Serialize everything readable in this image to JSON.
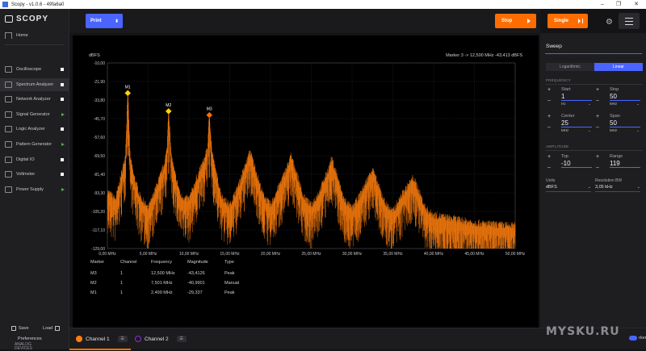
{
  "window": {
    "title": "Scopy - v1.0.6 - 49fa6a0",
    "controls": [
      "–",
      "❐",
      "✕"
    ]
  },
  "app": {
    "name": "SCOPY"
  },
  "sidebar": {
    "home": "Home",
    "items": [
      {
        "label": "Oscilloscope",
        "icon": "oscilloscope-icon",
        "state": "square"
      },
      {
        "label": "Spectrum Analyzer",
        "icon": "spectrum-icon",
        "state": "square",
        "active": true
      },
      {
        "label": "Network Analyzer",
        "icon": "network-icon",
        "state": "square"
      },
      {
        "label": "Signal Generator",
        "icon": "signal-icon",
        "state": "play"
      },
      {
        "label": "Logic Analyzer",
        "icon": "logic-icon",
        "state": "square"
      },
      {
        "label": "Pattern Generator",
        "icon": "pattern-icon",
        "state": "play"
      },
      {
        "label": "Digital IO",
        "icon": "digital-io-icon",
        "state": "square"
      },
      {
        "label": "Voltmeter",
        "icon": "voltmeter-icon",
        "state": "square"
      },
      {
        "label": "Power Supply",
        "icon": "power-icon",
        "state": "play"
      }
    ],
    "save": "Save",
    "load": "Load",
    "preferences": "Preferences",
    "brand_line1": "ANALOG",
    "brand_line2": "DEVICES"
  },
  "toolbar": {
    "print": "Print",
    "print_selector": "⬍",
    "stop": "Stop",
    "single": "Single"
  },
  "plot": {
    "unit_label": "dBFS",
    "marker_readout": "Marker 3 -> 12,500 MHz -43,413 dBFS",
    "y_ticks": [
      "-10,00",
      "-21,90",
      "-33,80",
      "-45,70",
      "-57,60",
      "-69,50",
      "-81,40",
      "-93,30",
      "-105,20",
      "-117,10",
      "-129,00"
    ],
    "x_ticks": [
      "0,00 MHz",
      "5,00 MHz",
      "10,00 MHz",
      "15,00 MHz",
      "20,00 MHz",
      "25,00 MHz",
      "30,00 MHz",
      "35,00 MHz",
      "40,00 MHz",
      "45,00 MHz",
      "50,00 MHz"
    ],
    "trace_color": "#ff7f0e",
    "markers": [
      {
        "name": "M1",
        "freq_mhz": 2.499,
        "dbfs": -29.337,
        "color": "#ffd400"
      },
      {
        "name": "M2",
        "freq_mhz": 7.501,
        "dbfs": -40.99,
        "color": "#ffd400"
      },
      {
        "name": "M3",
        "freq_mhz": 12.5,
        "dbfs": -43.41,
        "color": "#ff6d00"
      }
    ]
  },
  "marker_table": {
    "headers": [
      "Marker",
      "Channel",
      "Frequency",
      "Magnitude",
      "Type"
    ],
    "rows": [
      [
        "M3",
        "1",
        "12,500 MHz",
        "-43,4126",
        "Peak"
      ],
      [
        "M2",
        "1",
        "7,501 MHz",
        "-40,9901",
        "Manual"
      ],
      [
        "M1",
        "1",
        "2,499 MHz",
        "-29,337",
        "Peak"
      ]
    ]
  },
  "bottom": {
    "channel1": "Channel 1",
    "channel1_color": "#ff7f0e",
    "channel2": "Channel 2",
    "channel2_color": "#8a2be2",
    "menu_glyph": "☰",
    "markers_label": "rkers",
    "watermark": "MYSKU.RU"
  },
  "right_panel": {
    "title": "Sweep",
    "scale_logarithmic": "Logarithmic",
    "scale_linear": "Linear",
    "frequency_section": "FREQUENCY",
    "start": {
      "label": "Start",
      "value": "1",
      "unit": "Hz"
    },
    "stop": {
      "label": "Stop",
      "value": "50",
      "unit": "MHz"
    },
    "center": {
      "label": "Center",
      "value": "25",
      "unit": "MHz"
    },
    "span": {
      "label": "Span",
      "value": "50",
      "unit": "MHz"
    },
    "amplitude_section": "AMPLITUDE",
    "top": {
      "label": "Top",
      "value": "-10"
    },
    "range": {
      "label": "Range",
      "value": "119"
    },
    "units": {
      "label": "Units",
      "value": "dBFS"
    },
    "resolution_bw": {
      "label": "Resolution BW",
      "value": "3,05 kHz"
    }
  },
  "chart_data": {
    "type": "line",
    "title": "",
    "xlabel": "",
    "ylabel": "dBFS",
    "xlim": [
      0,
      50
    ],
    "ylim": [
      -129,
      -10
    ],
    "x_unit": "MHz",
    "grid": true,
    "series": [
      {
        "x": [
          0,
          1,
          1.8,
          2.2,
          2.499,
          2.8,
          3.2,
          4,
          5,
          6,
          6.9,
          7.3,
          7.501,
          7.8,
          8.2,
          9,
          10,
          11,
          11.9,
          12.3,
          12.5,
          12.8,
          13.2,
          14,
          15,
          16,
          17,
          17.5,
          18,
          19,
          20,
          21,
          22,
          22.5,
          23,
          24,
          25,
          26,
          27,
          27.5,
          28,
          29,
          30,
          31,
          32,
          32.5,
          33,
          34,
          35,
          36,
          37,
          37.5,
          38,
          39,
          40,
          42,
          45,
          47,
          50
        ],
        "y": [
          -95,
          -100,
          -82,
          -72,
          -29.3,
          -73,
          -84,
          -98,
          -106,
          -92,
          -79,
          -68,
          -41,
          -70,
          -82,
          -98,
          -100,
          -86,
          -74,
          -66,
          -43.4,
          -68,
          -80,
          -98,
          -104,
          -92,
          -77,
          -69,
          -78,
          -96,
          -104,
          -92,
          -80,
          -72,
          -80,
          -98,
          -104,
          -95,
          -82,
          -74,
          -82,
          -100,
          -106,
          -97,
          -86,
          -80,
          -88,
          -102,
          -108,
          -98,
          -90,
          -86,
          -92,
          -106,
          -110,
          -112,
          -115,
          -116,
          -117
        ]
      }
    ]
  }
}
